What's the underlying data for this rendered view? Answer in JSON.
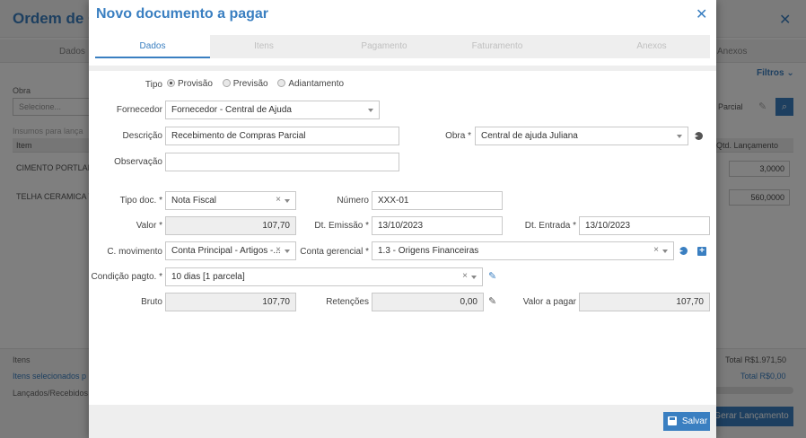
{
  "background": {
    "title": "Ordem de C",
    "tabs": [
      "Dados",
      "Anexos"
    ],
    "filters_label": "Filtros",
    "obra_label": "Obra",
    "obra_placeholder": "Selecione...",
    "parcial_label": "Parcial",
    "insumos_label": "Insumos para lança",
    "table_headers": {
      "item": "Item",
      "qtd": "Qtd. Lançamento"
    },
    "rows": [
      {
        "item": "CIMENTO PORTLAN",
        "qty": "3,0000"
      },
      {
        "item": "TELHA CERAMICA T",
        "qty": "560,0000"
      }
    ],
    "footer": {
      "itens": "Itens",
      "itens_selecionados": "Itens selecionados p",
      "lancados": "Lançados/Recebidos",
      "total": "Total  R$1.971,50",
      "total_sel": "Total  R$0,00",
      "gerar": "Gerar Lançamento"
    }
  },
  "modal": {
    "title": "Novo documento a pagar",
    "tabs": [
      "Dados",
      "Itens",
      "Pagamento",
      "Faturamento",
      "Anexos"
    ],
    "tipo": {
      "label": "Tipo",
      "options": [
        "Provisão",
        "Previsão",
        "Adiantamento"
      ],
      "selected_index": 0
    },
    "fornecedor": {
      "label": "Fornecedor",
      "value": "Fornecedor - Central de Ajuda"
    },
    "descricao": {
      "label": "Descrição",
      "value": "Recebimento de Compras Parcial"
    },
    "obra": {
      "label": "Obra *",
      "value": "Central de ajuda Juliana"
    },
    "observacao": {
      "label": "Observação",
      "value": ""
    },
    "tipo_doc": {
      "label": "Tipo doc. *",
      "value": "Nota Fiscal"
    },
    "numero": {
      "label": "Número",
      "value": "XXX-01"
    },
    "valor": {
      "label": "Valor *",
      "value": "107,70"
    },
    "dt_emissao": {
      "label": "Dt. Emissão *",
      "value": "13/10/2023"
    },
    "dt_entrada": {
      "label": "Dt. Entrada *",
      "value": "13/10/2023"
    },
    "c_movimento": {
      "label": "C. movimento",
      "value": "Conta Principal - Artigos -..."
    },
    "conta_gerencial": {
      "label": "Conta gerencial *",
      "value": "1.3 - Origens Financeiras"
    },
    "condicao_pagto": {
      "label": "Condição pagto. *",
      "value": "10 dias [1 parcela]"
    },
    "bruto": {
      "label": "Bruto",
      "value": "107,70"
    },
    "retencoes": {
      "label": "Retenções",
      "value": "0,00"
    },
    "valor_pagar": {
      "label": "Valor a pagar",
      "value": "107,70"
    },
    "save_label": "Salvar"
  },
  "colors": {
    "accent": "#3a7fc1",
    "readonly_bg": "#eeeeee"
  }
}
